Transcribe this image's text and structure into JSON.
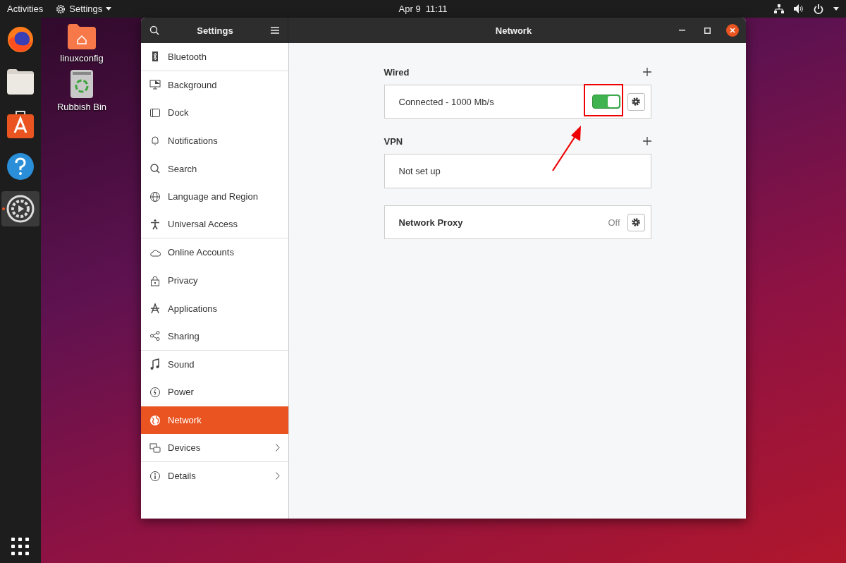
{
  "top_bar": {
    "activities": "Activities",
    "app_menu": "Settings",
    "clock": "Apr 9  11:11"
  },
  "dock": {
    "items": [
      {
        "running": false
      },
      {
        "running": false
      },
      {
        "running": false
      },
      {
        "running": false
      },
      {
        "running": true
      }
    ]
  },
  "desktop_icons": [
    {
      "label": "linuxconfig"
    },
    {
      "label": "Rubbish Bin"
    }
  ],
  "window": {
    "sidebar_title": "Settings",
    "title": "Network"
  },
  "sidebar": {
    "items": [
      {
        "label": "Bluetooth",
        "selected": false,
        "submenu": false,
        "separator_after": true
      },
      {
        "label": "Background",
        "selected": false,
        "submenu": false,
        "separator_after": false
      },
      {
        "label": "Dock",
        "selected": false,
        "submenu": false,
        "separator_after": false
      },
      {
        "label": "Notifications",
        "selected": false,
        "submenu": false,
        "separator_after": false
      },
      {
        "label": "Search",
        "selected": false,
        "submenu": false,
        "separator_after": false
      },
      {
        "label": "Language and Region",
        "selected": false,
        "submenu": false,
        "separator_after": false
      },
      {
        "label": "Universal Access",
        "selected": false,
        "submenu": false,
        "separator_after": true
      },
      {
        "label": "Online Accounts",
        "selected": false,
        "submenu": false,
        "separator_after": false
      },
      {
        "label": "Privacy",
        "selected": false,
        "submenu": false,
        "separator_after": false
      },
      {
        "label": "Applications",
        "selected": false,
        "submenu": false,
        "separator_after": false
      },
      {
        "label": "Sharing",
        "selected": false,
        "submenu": false,
        "separator_after": true
      },
      {
        "label": "Sound",
        "selected": false,
        "submenu": false,
        "separator_after": false
      },
      {
        "label": "Power",
        "selected": false,
        "submenu": false,
        "separator_after": false
      },
      {
        "label": "Network",
        "selected": true,
        "submenu": false,
        "separator_after": false
      },
      {
        "label": "Devices",
        "selected": false,
        "submenu": true,
        "separator_after": true
      },
      {
        "label": "Details",
        "selected": false,
        "submenu": true,
        "separator_after": false
      }
    ]
  },
  "panel": {
    "sections": [
      {
        "title": "Wired",
        "rows": [
          {
            "kind": "toggle",
            "label": "Connected - 1000 Mb/s",
            "on": true,
            "highlighted": true
          }
        ]
      },
      {
        "title": "VPN",
        "rows": [
          {
            "kind": "text",
            "label": "Not set up"
          }
        ]
      },
      {
        "rows": [
          {
            "kind": "proxy",
            "label": "Network Proxy",
            "value": "Off"
          }
        ]
      }
    ]
  }
}
